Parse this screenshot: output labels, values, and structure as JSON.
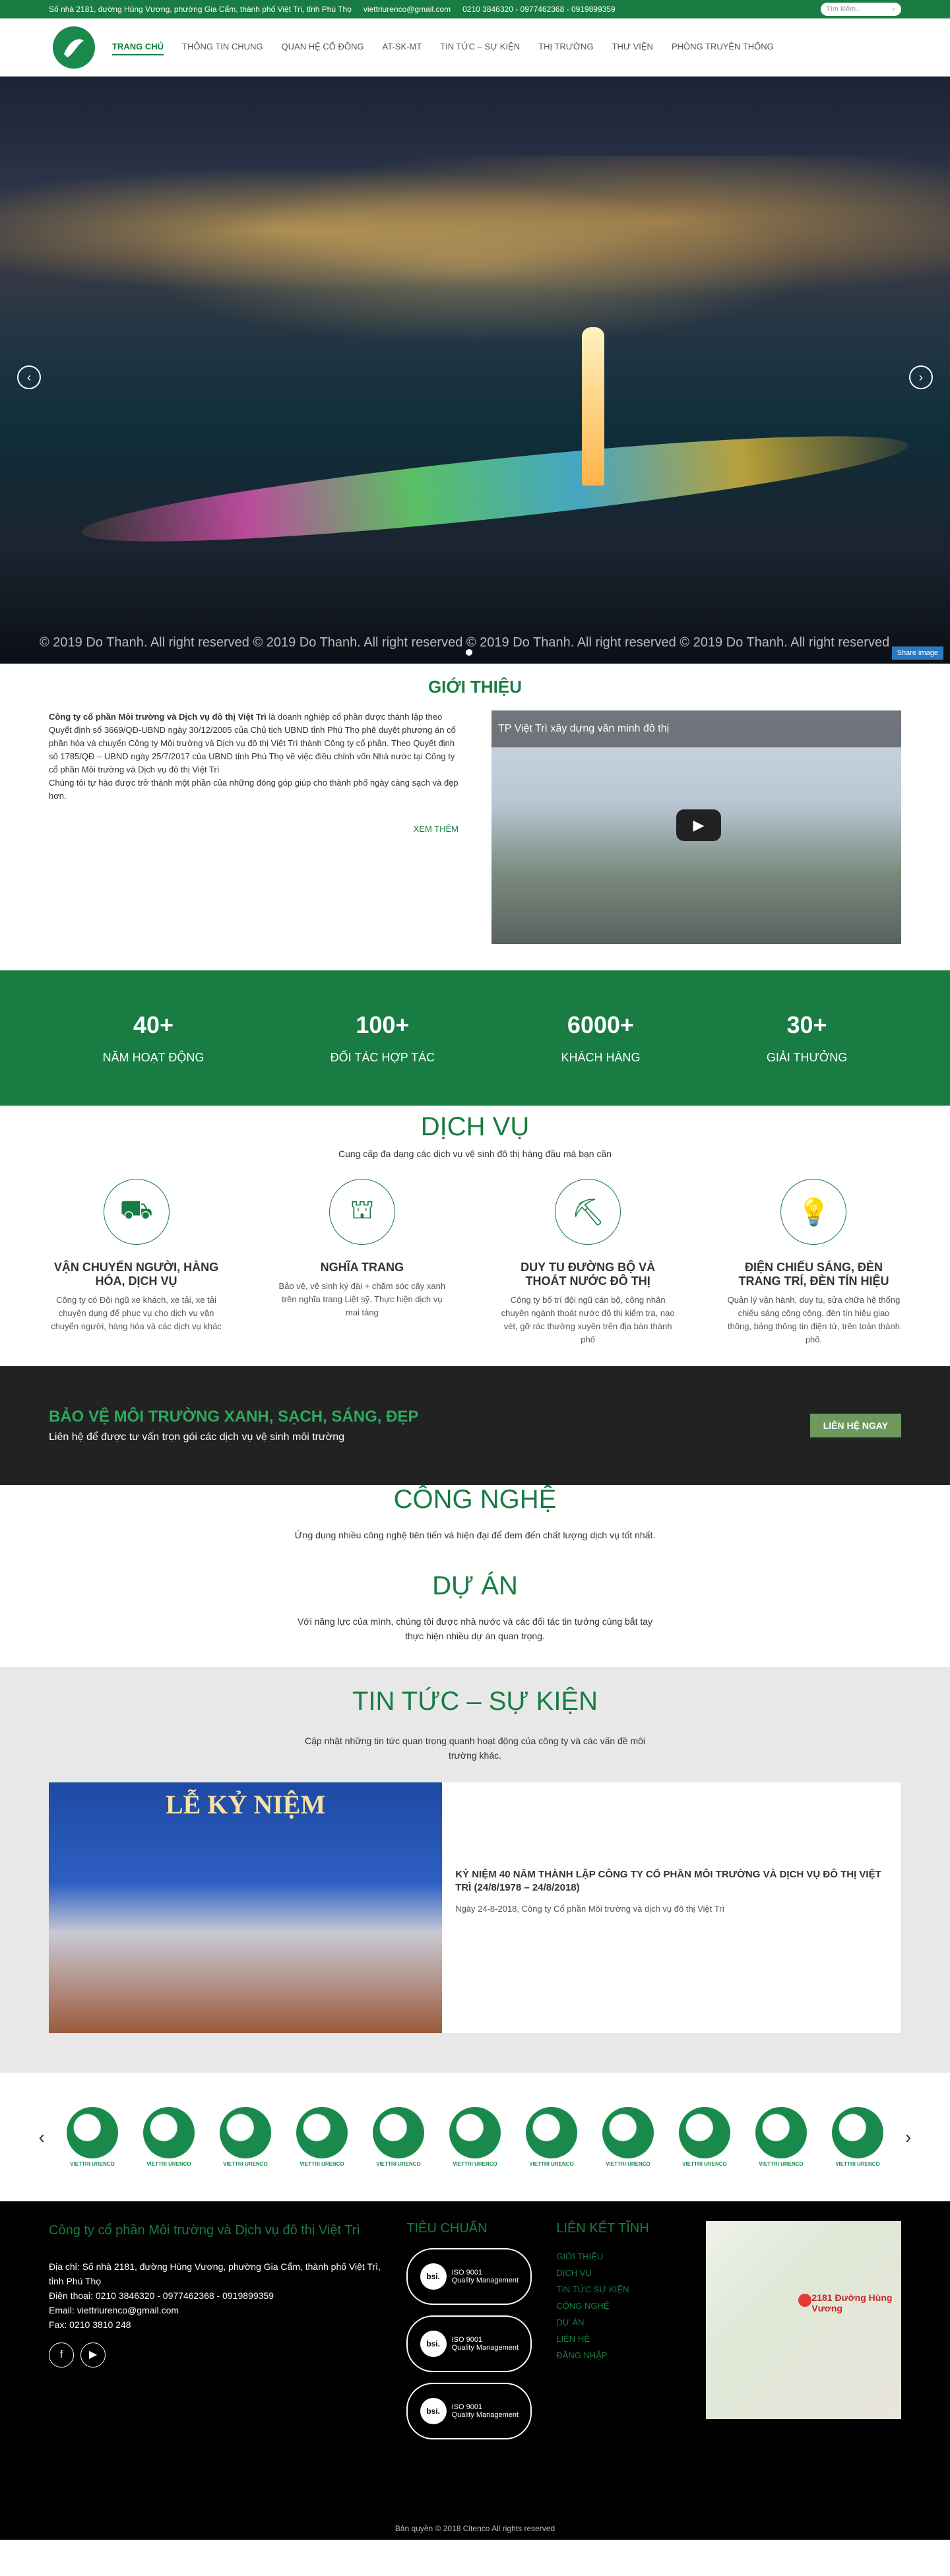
{
  "topbar": {
    "address": "Số nhà 2181, đường Hùng Vương, phường Gia Cẩm, thành phố Việt Trì, tỉnh Phú Thọ",
    "email": "viettriurenco@gmail.com",
    "phone": "0210 3846320 - 0977462368 - 0919899359",
    "search_placeholder": "Tìm kiếm..."
  },
  "nav": [
    "TRANG CHỦ",
    "THÔNG TIN CHUNG",
    "QUAN HỆ CỔ ĐÔNG",
    "AT-SK-MT",
    "TIN TỨC – SỰ KIỆN",
    "THỊ TRƯỜNG",
    "THƯ VIỆN",
    "PHÒNG TRUYỀN THỐNG"
  ],
  "hero": {
    "copyright": "© 2019 Do Thanh. All right reserved © 2019 Do Thanh. All right reserved © 2019 Do Thanh. All right reserved © 2019 Do Thanh. All right reserved",
    "share": "Share image"
  },
  "intro": {
    "title": "GIỚI THIỆU",
    "strong": "Công ty cổ phần Môi trường và Dịch vụ đô thị Việt Trì",
    "body": " là doanh nghiệp cổ phần được thành lập theo Quyết định số 3669/QĐ-UBND ngày 30/12/2005 của Chủ tịch UBND tỉnh Phú Thọ phê duyệt phương án cổ phần hóa và chuyển Công ty Môi trường và Dịch vụ đô thị Việt Trì thành Công ty cổ phần. Theo Quyết định số 1785/QĐ – UBND ngày 25/7/2017 của UBND tỉnh Phú Thọ về việc điều chỉnh vốn Nhà nước tại Công ty cổ phần Môi trường và Dịch vụ đô thị Việt Trì",
    "body2": "Chúng tôi tự hào được trở thành một phần của những đóng góp giúp cho thành phố ngày càng sạch và đẹp hơn.",
    "more": "XEM THÊM",
    "video_title": "TP Việt Trì xây dựng văn minh đô thị"
  },
  "stats": [
    {
      "num": "40+",
      "lbl": "NĂM HOẠT ĐỘNG"
    },
    {
      "num": "100+",
      "lbl": "ĐỐI TÁC HỢP TÁC"
    },
    {
      "num": "6000+",
      "lbl": "KHÁCH HÀNG"
    },
    {
      "num": "30+",
      "lbl": "GIẢI THƯỞNG"
    }
  ],
  "services": {
    "title": "DỊCH VỤ",
    "sub": "Cung cấp đa dạng các dịch vụ vệ sinh đô thị hàng đầu mà bạn cần",
    "items": [
      {
        "icon": "truck-icon",
        "t": "VẬN CHUYỂN NGƯỜI, HÀNG HÓA, DỊCH VỤ",
        "d": "Công ty có Đội ngũ xe khách, xe tải, xe tải chuyên dụng để phục vụ cho dịch vụ vận chuyển người, hàng hóa và các dịch vụ khác"
      },
      {
        "icon": "tombstone-icon",
        "t": "NGHĨA TRANG",
        "d": "Bảo vệ, vệ sinh ký đài + chăm sóc cây xanh trên nghĩa trang Liệt sỹ. Thực hiện dịch vụ mai táng"
      },
      {
        "icon": "road-icon",
        "t": "DUY TU ĐƯỜNG BỘ VÀ THOÁT NƯỚC ĐÔ THỊ",
        "d": "Công ty bố trí đội ngũ cán bộ, công nhân chuyên ngành thoát nước đô thị kiểm tra, nạo vét, gỡ rác thường xuyên trên địa bàn thành phố"
      },
      {
        "icon": "lamp-icon",
        "t": "ĐIỆN CHIẾU SÁNG, ĐÈN TRANG TRÍ, ĐÈN TÍN HIỆU",
        "d": "Quản lý vận hành, duy tu, sửa chữa hệ thống chiếu sáng công cộng, đèn tín hiệu giao thông, bảng thông tin điện tử, trên toàn thành phố."
      }
    ]
  },
  "cta": {
    "title": "BẢO VỆ MÔI TRƯỜNG XANH, SẠCH, SÁNG, ĐẸP",
    "sub": "Liên hệ để được tư vấn trọn gói các dịch vụ vệ sinh môi trường",
    "btn": "LIÊN HỆ NGAY"
  },
  "tech": {
    "title": "CÔNG NGHỆ",
    "p": "Ứng dụng nhiều công nghệ tiên tiến và hiện đại để đem đến chất lượng dịch vụ tốt nhất."
  },
  "projects": {
    "title": "DỰ ÁN",
    "p": "Với năng lực của mình, chúng tôi được nhà nước và các đối tác tin tưởng cùng bắt tay thực hiện nhiều dự án quan trọng."
  },
  "news": {
    "title": "TIN TỨC – SỰ KIỆN",
    "p": "Cập nhật những tin tức quan trọng quanh hoạt động của công ty và các vấn đề môi trường khác.",
    "banner": "LỄ KỶ NIỆM",
    "card_title": "KỶ NIỆM 40 NĂM THÀNH LẬP CÔNG TY CỔ PHẦN MÔI TRƯỜNG VÀ DỊCH VỤ ĐÔ THỊ VIỆT TRÌ (24/8/1978 – 24/8/2018)",
    "card_desc": "Ngày 24-8-2018, Công ty Cổ phần Môi trường và dịch vụ đô thị Việt Trì"
  },
  "partners": {
    "name": "VIETTRI URENCO",
    "count": 11
  },
  "footer": {
    "company": "Công ty cổ phần Môi trường và Dịch vụ đô thị Việt Trì",
    "address": "Địa chỉ: Số nhà 2181, đường Hùng Vương, phường Gia Cẩm, thành phố Việt Trì, tỉnh Phú Thọ",
    "phone": "Điện thoại: 0210 3846320 - 0977462368 - 0919899359",
    "email": "Email: viettriurenco@gmail.com",
    "fax": "Fax: 0210 3810 248",
    "std_title": "TIÊU CHUẨN",
    "iso": "ISO 9001",
    "iso_sub": "Quality Management",
    "links_title": "LIÊN KẾT TĨNH",
    "links": [
      "GIỚI THIỆU",
      "DỊCH VỤ",
      "TIN TỨC SỰ KIỆN",
      "CÔNG NGHỆ",
      "DỰ ÁN",
      "LIÊN HỆ",
      "ĐĂNG NHẬP"
    ],
    "map_label": "2181 Đường Hùng Vương",
    "copyright": "Bản quyền © 2018 Citenco All rights reserved"
  }
}
